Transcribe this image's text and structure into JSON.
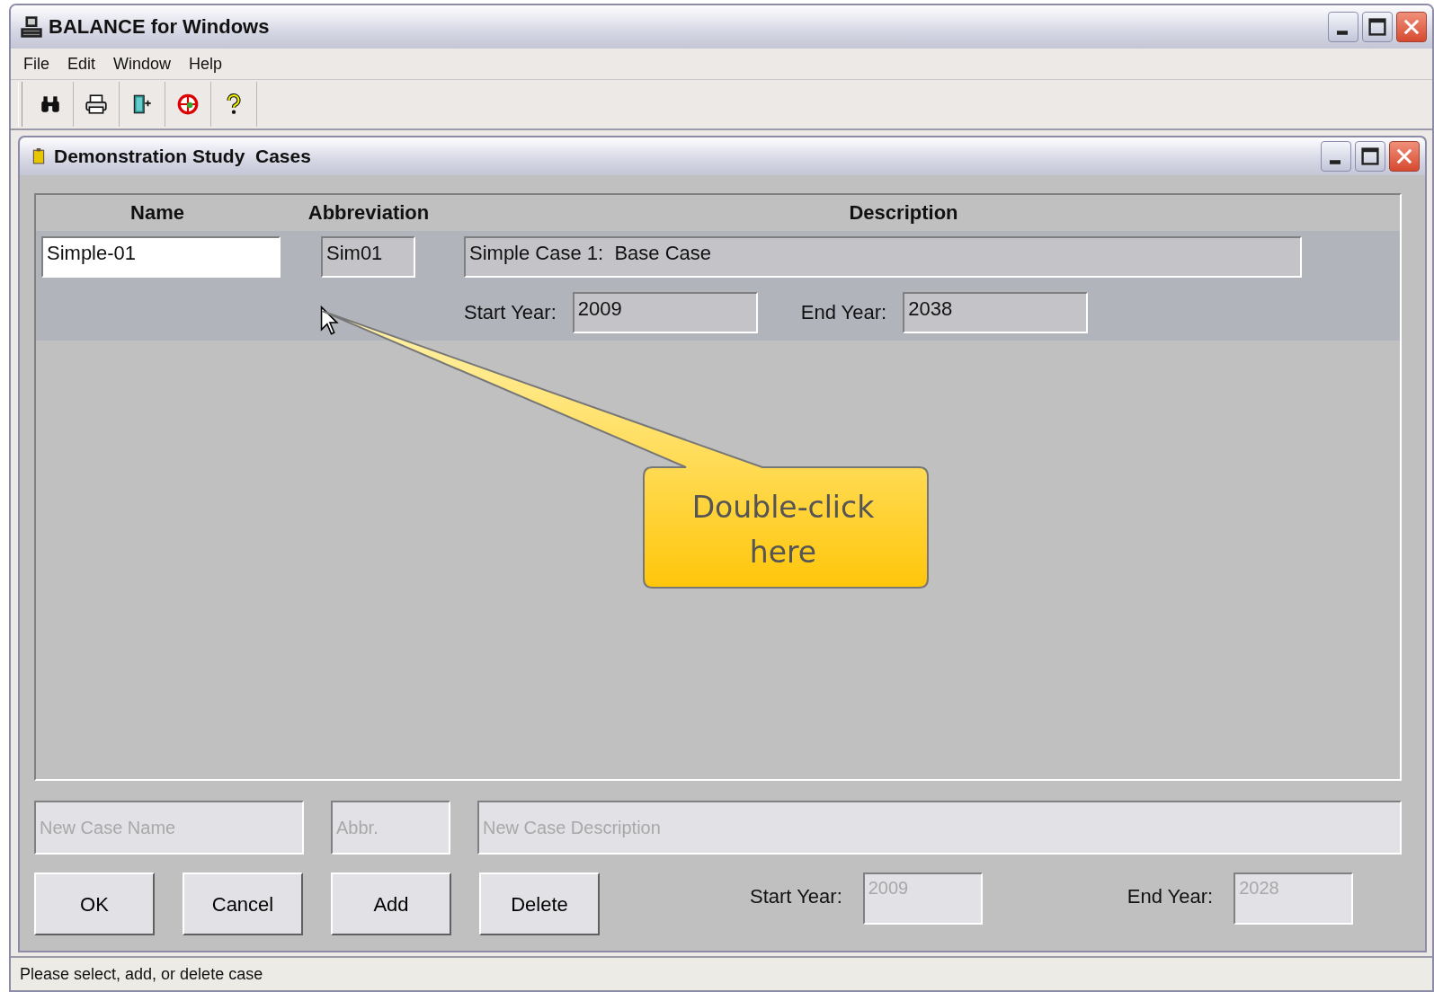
{
  "window": {
    "title": "BALANCE for Windows"
  },
  "menu": [
    {
      "label": "File"
    },
    {
      "label": "Edit"
    },
    {
      "label": "Window"
    },
    {
      "label": "Help"
    }
  ],
  "child_window": {
    "title": "Demonstration Study  Cases"
  },
  "table": {
    "columns": [
      "Name",
      "Abbreviation",
      "Description"
    ],
    "rows": [
      {
        "name": "Simple-01",
        "abbreviation": "Sim01",
        "description": "Simple Case 1:  Base Case",
        "start_label": "Start Year:",
        "start_year": "2009",
        "end_label": "End Year:",
        "end_year": "2038",
        "selected": true
      }
    ]
  },
  "new_case": {
    "name_placeholder": "New Case Name",
    "abbreviation_placeholder": "Abbr.",
    "description_placeholder": "New Case Description"
  },
  "buttons": [
    "OK",
    "Cancel",
    "Add",
    "Delete"
  ],
  "new_case_years": {
    "start_label": "Start Year:",
    "start_year": "2009",
    "end_label": "End Year:",
    "end_year": "2028"
  },
  "callout": {
    "text": "Double-click here"
  },
  "status_bar": {
    "text": "Please select, add, or delete case"
  }
}
